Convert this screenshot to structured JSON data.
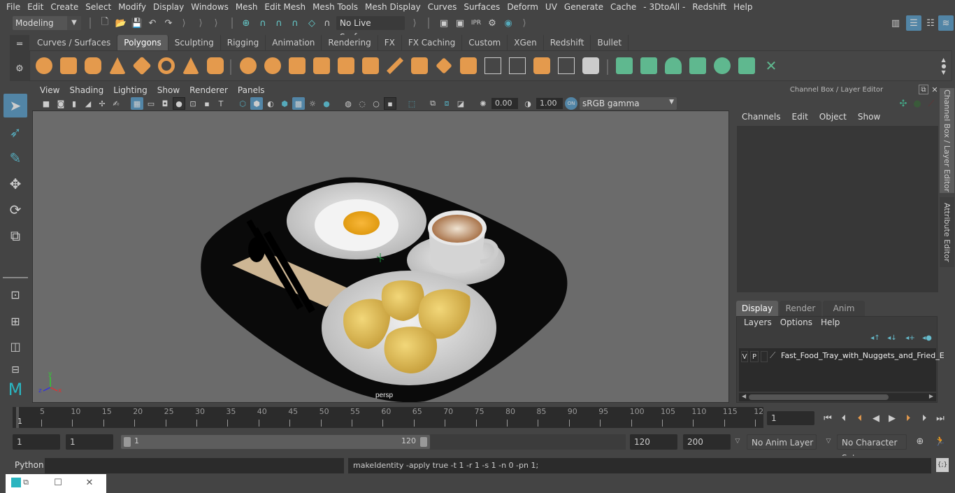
{
  "menubar": {
    "items": [
      "File",
      "Edit",
      "Create",
      "Select",
      "Modify",
      "Display",
      "Windows",
      "Mesh",
      "Edit Mesh",
      "Mesh Tools",
      "Mesh Display",
      "Curves",
      "Surfaces",
      "Deform",
      "UV",
      "Generate",
      "Cache",
      "- 3DtoAll -",
      "Redshift",
      "Help"
    ]
  },
  "toolbar": {
    "mode": "Modeling",
    "live_surface": "No Live Surface"
  },
  "shelf": {
    "tabs": [
      "Curves / Surfaces",
      "Polygons",
      "Sculpting",
      "Rigging",
      "Animation",
      "Rendering",
      "FX",
      "FX Caching",
      "Custom",
      "XGen",
      "Redshift",
      "Bullet"
    ],
    "active_tab": "Polygons"
  },
  "viewport": {
    "menus": [
      "View",
      "Shading",
      "Lighting",
      "Show",
      "Renderer",
      "Panels"
    ],
    "exposure": "0.00",
    "gamma": "1.00",
    "color_space": "sRGB gamma",
    "camera_label": "persp",
    "axis_labels": {
      "x": "x",
      "y": "y",
      "z": "z"
    }
  },
  "channel_box": {
    "title": "Channel Box / Layer Editor",
    "menus": [
      "Channels",
      "Edit",
      "Object",
      "Show"
    ]
  },
  "side_tabs": [
    "Channel Box / Layer Editor",
    "Attribute Editor"
  ],
  "layer_editor": {
    "tabs": [
      "Display",
      "Render",
      "Anim"
    ],
    "active_tab": "Display",
    "menus": [
      "Layers",
      "Options",
      "Help"
    ],
    "layers": [
      {
        "v": "V",
        "p": "P",
        "name": "Fast_Food_Tray_with_Nuggets_and_Fried_E"
      }
    ]
  },
  "timeline": {
    "ticks": [
      "5",
      "10",
      "15",
      "20",
      "25",
      "30",
      "35",
      "40",
      "45",
      "50",
      "55",
      "60",
      "65",
      "70",
      "75",
      "80",
      "85",
      "90",
      "95",
      "100",
      "105",
      "110",
      "115",
      "12"
    ],
    "current_marker": "1",
    "current_frame": "1"
  },
  "range": {
    "start": "1",
    "playback_start": "1",
    "slider_start": "1",
    "slider_end": "120",
    "playback_end": "120",
    "end": "200",
    "anim_layer": "No Anim Layer",
    "character_set": "No Character Set"
  },
  "command_line": {
    "language": "Python",
    "input": "",
    "result": "makeIdentity -apply true -t 1 -r 1 -s 1 -n 0 -pn 1;"
  }
}
